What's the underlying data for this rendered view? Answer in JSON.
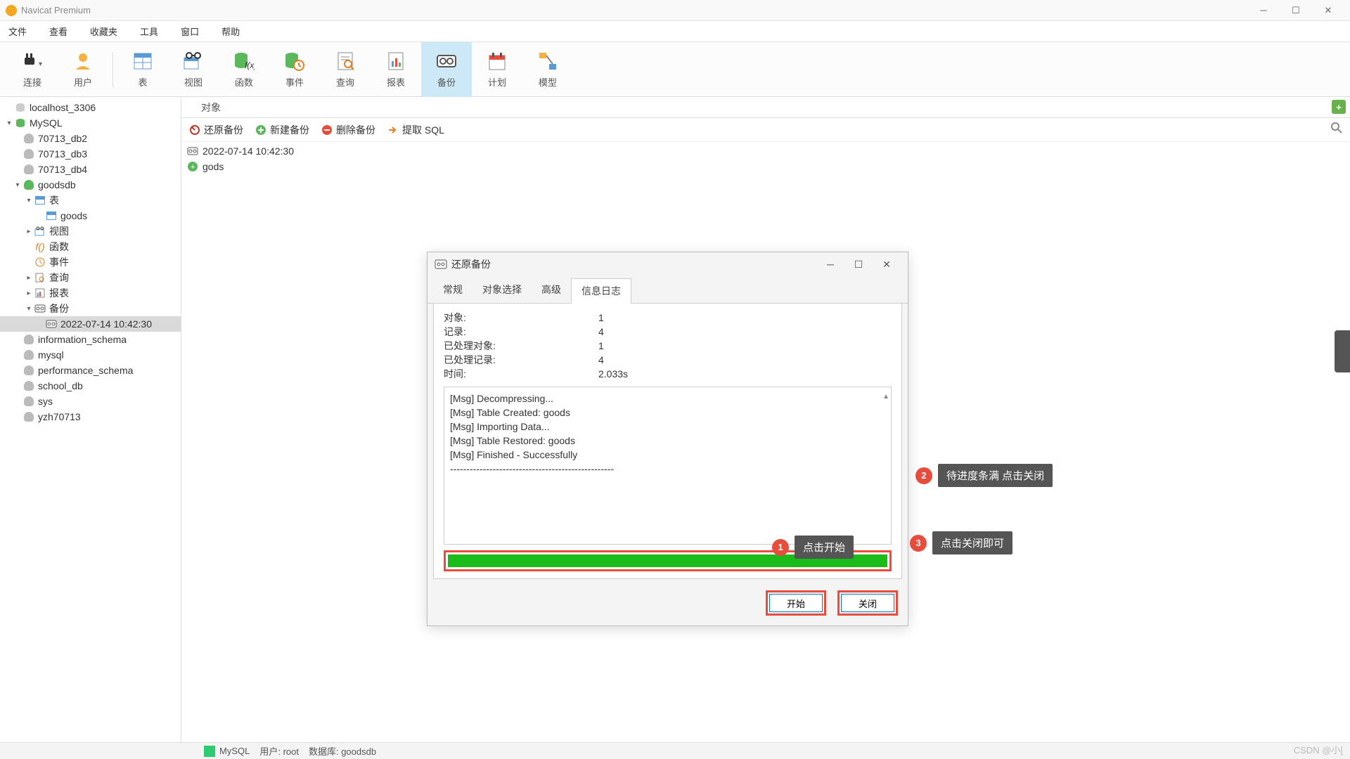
{
  "app": {
    "title": "Navicat Premium"
  },
  "menu": {
    "file": "文件",
    "view": "查看",
    "fav": "收藏夹",
    "tool": "工具",
    "window": "窗口",
    "help": "帮助"
  },
  "toolbar": {
    "connect": "连接",
    "user": "用户",
    "table": "表",
    "view": "视图",
    "function": "函数",
    "event": "事件",
    "query": "查询",
    "report": "报表",
    "backup": "备份",
    "plan": "计划",
    "model": "模型"
  },
  "tree": {
    "localhost": "localhost_3306",
    "mysql": "MySQL",
    "db2": "70713_db2",
    "db3": "70713_db3",
    "db4": "70713_db4",
    "goodsdb": "goodsdb",
    "tables": "表",
    "goods_table": "goods",
    "views": "视图",
    "functions": "函数",
    "events": "事件",
    "queries": "查询",
    "reports": "报表",
    "backups": "备份",
    "backup_item": "2022-07-14 10:42:30",
    "info_schema": "information_schema",
    "mysql_db": "mysql",
    "perf_schema": "performance_schema",
    "school_db": "school_db",
    "sys": "sys",
    "yzh": "yzh70713"
  },
  "contentTabs": {
    "objects": "对象"
  },
  "actions": {
    "restore": "还原备份",
    "new": "新建备份",
    "delete": "删除备份",
    "extract": "提取 SQL"
  },
  "list": {
    "item1": "2022-07-14 10:42:30",
    "item2": "gods"
  },
  "dialog": {
    "title": "还原备份",
    "tabs": {
      "general": "常规",
      "obj": "对象选择",
      "adv": "高级",
      "log": "信息日志"
    },
    "stats": {
      "objects_label": "对象:",
      "objects_val": "1",
      "records_label": "记录:",
      "records_val": "4",
      "proc_obj_label": "已处理对象:",
      "proc_obj_val": "1",
      "proc_rec_label": "已处理记录:",
      "proc_rec_val": "4",
      "time_label": "时间:",
      "time_val": "2.033s"
    },
    "log": {
      "l1": "[Msg] Decompressing...",
      "l2": "[Msg] Table Created: goods",
      "l3": "[Msg] Importing Data...",
      "l4": "[Msg] Table Restored: goods",
      "l5": "[Msg] Finished - Successfully",
      "l6": "--------------------------------------------------"
    },
    "start": "开始",
    "close": "关闭"
  },
  "callouts": {
    "c1": "点击开始",
    "c2": "待进度条满 点击关闭",
    "c3": "点击关闭即可"
  },
  "status": {
    "db": "MySQL",
    "user_label": "用户: root",
    "db_label": "数据库: goodsdb"
  },
  "watermark": "CSDN @小["
}
